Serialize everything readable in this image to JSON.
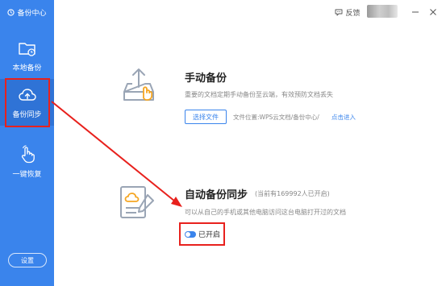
{
  "app": {
    "title": "备份中心"
  },
  "sidebar": {
    "items": [
      {
        "label": "本地备份",
        "icon": "folder-clock-icon"
      },
      {
        "label": "备份同步",
        "icon": "cloud-upload-icon"
      },
      {
        "label": "一键恢复",
        "icon": "hand-pointer-icon"
      }
    ],
    "settings_label": "设置"
  },
  "titlebar": {
    "feedback_label": "反馈"
  },
  "manual_backup": {
    "title": "手动备份",
    "description": "重要的文档定期手动备份至云端，有效预防文档丢失",
    "choose_button": "选择文件",
    "location_text": "文件位置:WPS云文档/备份中心/",
    "enter_link": "点击进入"
  },
  "auto_sync": {
    "title": "自动备份同步",
    "subtitle": "(当前有169992人已开启)",
    "description": "可以从自己的手机或其他电脑访问这台电脑打开过的文档",
    "toggle_label": "已开启",
    "toggle_on": true
  },
  "colors": {
    "sidebar": "#3a84ec",
    "sidebar_active": "#2f73d6",
    "accent": "#3a84ec",
    "annotation": "#e8211d"
  }
}
